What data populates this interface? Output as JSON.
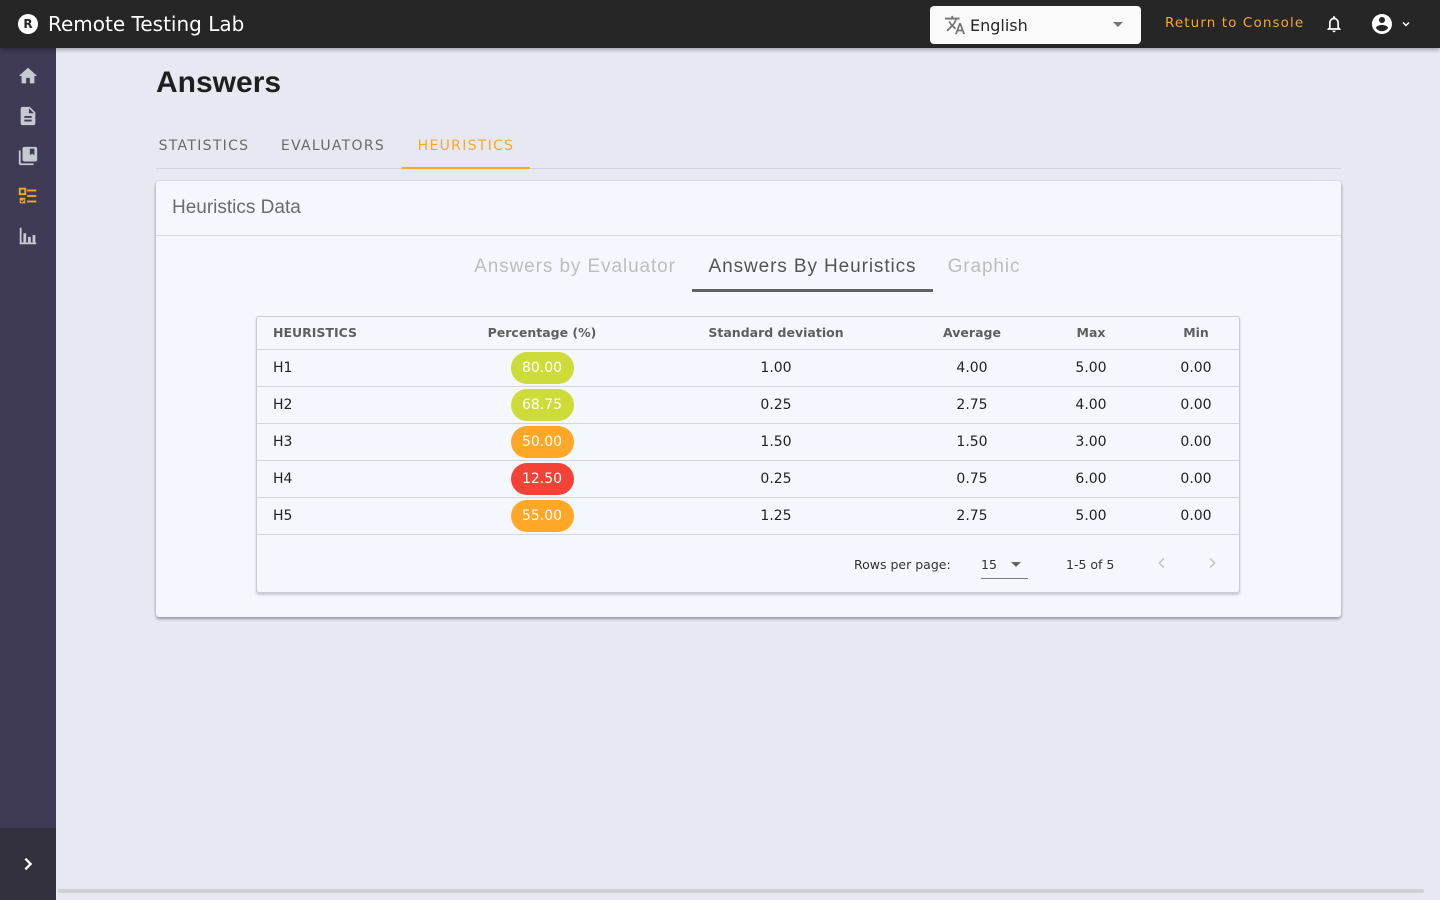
{
  "app": {
    "title": "Remote Testing Lab",
    "logo_letter": "R"
  },
  "topbar": {
    "language": {
      "selected": "English",
      "icon": "translate-icon"
    },
    "return_link": "Return to Console",
    "icons": [
      "bell-icon",
      "account-circle-icon",
      "chevron-down-icon"
    ]
  },
  "sidebar": {
    "items": [
      {
        "name": "home",
        "icon": "home-icon",
        "active": false
      },
      {
        "name": "document",
        "icon": "file-document-icon",
        "active": false
      },
      {
        "name": "library",
        "icon": "library-books-icon",
        "active": false
      },
      {
        "name": "answers",
        "icon": "checklist-icon",
        "active": true
      },
      {
        "name": "analytics",
        "icon": "bar-chart-icon",
        "active": false
      }
    ],
    "expand_icon": "chevron-right-icon"
  },
  "page": {
    "title": "Answers",
    "tabs": [
      {
        "label": "STATISTICS",
        "active": false
      },
      {
        "label": "EVALUATORS",
        "active": false
      },
      {
        "label": "HEURISTICS",
        "active": true
      }
    ]
  },
  "card": {
    "title": "Heuristics Data",
    "subtabs": [
      {
        "label": "Answers by Evaluator",
        "active": false
      },
      {
        "label": "Answers By Heuristics",
        "active": true
      },
      {
        "label": "Graphic",
        "active": false
      }
    ],
    "table": {
      "headers": [
        "HEURISTICS",
        "Percentage (%)",
        "Standard deviation",
        "Average",
        "Max",
        "Min"
      ],
      "rows": [
        {
          "heuristic": "H1",
          "percentage": "80.00",
          "color": "#cddc39",
          "std": "1.00",
          "avg": "4.00",
          "max": "5.00",
          "min": "0.00"
        },
        {
          "heuristic": "H2",
          "percentage": "68.75",
          "color": "#cddc39",
          "std": "0.25",
          "avg": "2.75",
          "max": "4.00",
          "min": "0.00"
        },
        {
          "heuristic": "H3",
          "percentage": "50.00",
          "color": "#ffa726",
          "std": "1.50",
          "avg": "1.50",
          "max": "3.00",
          "min": "0.00"
        },
        {
          "heuristic": "H4",
          "percentage": "12.50",
          "color": "#f44336",
          "std": "0.25",
          "avg": "0.75",
          "max": "6.00",
          "min": "0.00"
        },
        {
          "heuristic": "H5",
          "percentage": "55.00",
          "color": "#ffa726",
          "std": "1.25",
          "avg": "2.75",
          "max": "5.00",
          "min": "0.00"
        }
      ]
    },
    "pagination": {
      "rows_per_page_label": "Rows per page:",
      "rows_per_page": "15",
      "range": "1-5 of 5"
    }
  },
  "colors": {
    "accent": "#f9a825",
    "topbar": "#262626",
    "sidebar": "#3f3b56"
  }
}
